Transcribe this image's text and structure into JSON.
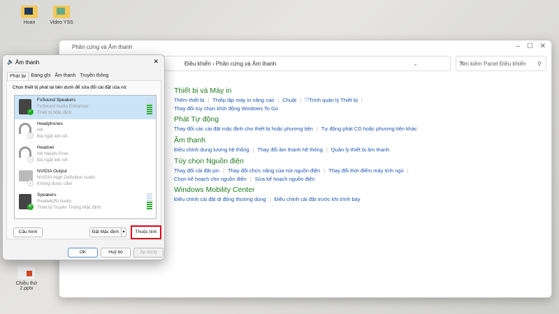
{
  "desktop": {
    "icons": [
      "Hoan",
      "Video YSS",
      "Chiều thứ 2.pptx"
    ]
  },
  "control_panel": {
    "title": "Phần cứng và Âm thanh",
    "breadcrumb": [
      "Điều khiển",
      "Phần cứng và Âm thanh"
    ],
    "search_placeholder": "Tìm kiếm Panel Điều khiển",
    "sections": [
      {
        "title": "Thiết bị và Máy in",
        "links": [
          "Thêm thiết bị",
          "Thiếp lập máy in nâng cao",
          "Chuột",
          "Trình quản lý Thiết bị"
        ],
        "links2": [
          "Thay đổi tùy chọn khởi động Windows To Go"
        ]
      },
      {
        "title": "Phát Tự động",
        "links": [
          "Thay đổi các cài đặt mặc định cho thiết bị hoặc phương tiện",
          "Tự động phát CD hoặc phương tiện khác"
        ]
      },
      {
        "title": "Âm thanh",
        "links": [
          "Điều chỉnh dung lượng hệ thống",
          "Thay đổi âm thanh hệ thống",
          "Quản lý thiết bị âm thanh"
        ]
      },
      {
        "title": "Tùy chọn Nguồn điện",
        "links": [
          "Thay đổi cài đặt pin",
          "Thay đổi chức năng của nút nguồn điện",
          "Thay đổi thời điểm máy tính ngủ"
        ],
        "links2": [
          "Chọn kế hoạch cho nguồn điện",
          "Sửa kế hoạch nguồn điện"
        ]
      },
      {
        "title": "Windows Mobility Center",
        "links": [
          "Điều chỉnh cài đặt di động thường dùng",
          "Điều chỉnh cài đặt trước khi trình bày"
        ]
      }
    ]
  },
  "sound_dialog": {
    "title": "Âm thanh",
    "tabs": [
      "Phát lại",
      "Đang ghi",
      "Âm thanh",
      "Truyền thông"
    ],
    "instruction": "Chọn thiết bị phát lại bên dưới để sửa đổi cài đặt của nó:",
    "devices": [
      {
        "name": "FxSound Speakers",
        "driver": "FxSound Audio Enhancer",
        "status": "Thiết bị Mặc định",
        "level": 0.6
      },
      {
        "name": "Headphones",
        "driver": "H6",
        "status": "Đã ngắt kết nối"
      },
      {
        "name": "Headset",
        "driver": "H6 Hands-Free",
        "status": "Đã ngắt kết nối"
      },
      {
        "name": "NVIDIA Output",
        "driver": "NVIDIA High Definition Audio",
        "status": "Không được cắm"
      },
      {
        "name": "Speakers",
        "driver": "Realtek(R) Audio",
        "status": "Thiết bị Truyền Thông Mặc định",
        "level": 0.5
      }
    ],
    "configure": "Cấu hình",
    "set_default": "Đặt Mặc định",
    "properties": "Thuộc tính",
    "ok": "OK",
    "cancel": "Huỷ bỏ",
    "apply": "Áp dụng"
  },
  "colors": {
    "highlight": "#e0001a",
    "link": "#1a55b0",
    "heading": "#1e7a1e"
  }
}
